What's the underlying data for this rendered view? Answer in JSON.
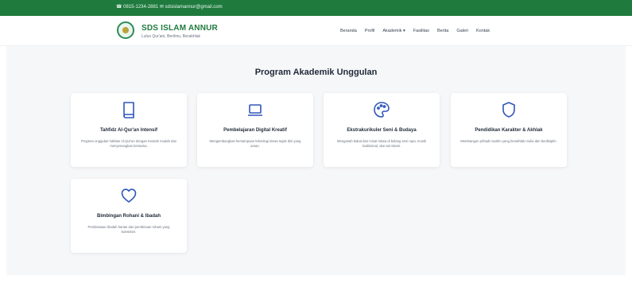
{
  "topbar": {
    "contact": "☎ 0815-1234-2881  ✉ sdsislamannur@gmail.com"
  },
  "header": {
    "name": "SDS ISLAM ANNUR",
    "tagline": "Lulus Qur'ani, Berilmu, Berakhlak"
  },
  "nav": [
    "Beranda",
    "Profil",
    "Akademik ▾",
    "Fasilitas",
    "Berita",
    "Galeri",
    "Kontak"
  ],
  "section": {
    "title": "Program Akademik Unggulan"
  },
  "programs": [
    {
      "icon": "book-icon",
      "title": "Tahfidz Al-Qur'an Intensif",
      "desc": "Program unggulan hafalan Al-Qur'an dengan metode mudah dan menyenangkan bersama."
    },
    {
      "icon": "laptop-icon",
      "title": "Pembelajaran Digital Kreatif",
      "desc": "Mengembangkan kemampuan teknologi siswa sejak dini yang aman."
    },
    {
      "icon": "palette-icon",
      "title": "Ekstrakurikuler Seni & Budaya",
      "desc": "Mengasah bakat dan minat siswa di bidang seni rupa, musik tradisional, dan tari islami."
    },
    {
      "icon": "shield-icon",
      "title": "Pendidikan Karakter & Akhlak",
      "desc": "Membangun pribadi muslim yang berakhlak mulia dan berdisiplin."
    },
    {
      "icon": "heart-icon",
      "title": "Bimbingan Rohani & Ibadah",
      "desc": "Pembiasaan ibadah harian dan pembinaan rohani yang konsisten."
    }
  ],
  "colors": {
    "brand_green": "#1f7a3e",
    "icon_blue": "#2f56b8"
  }
}
